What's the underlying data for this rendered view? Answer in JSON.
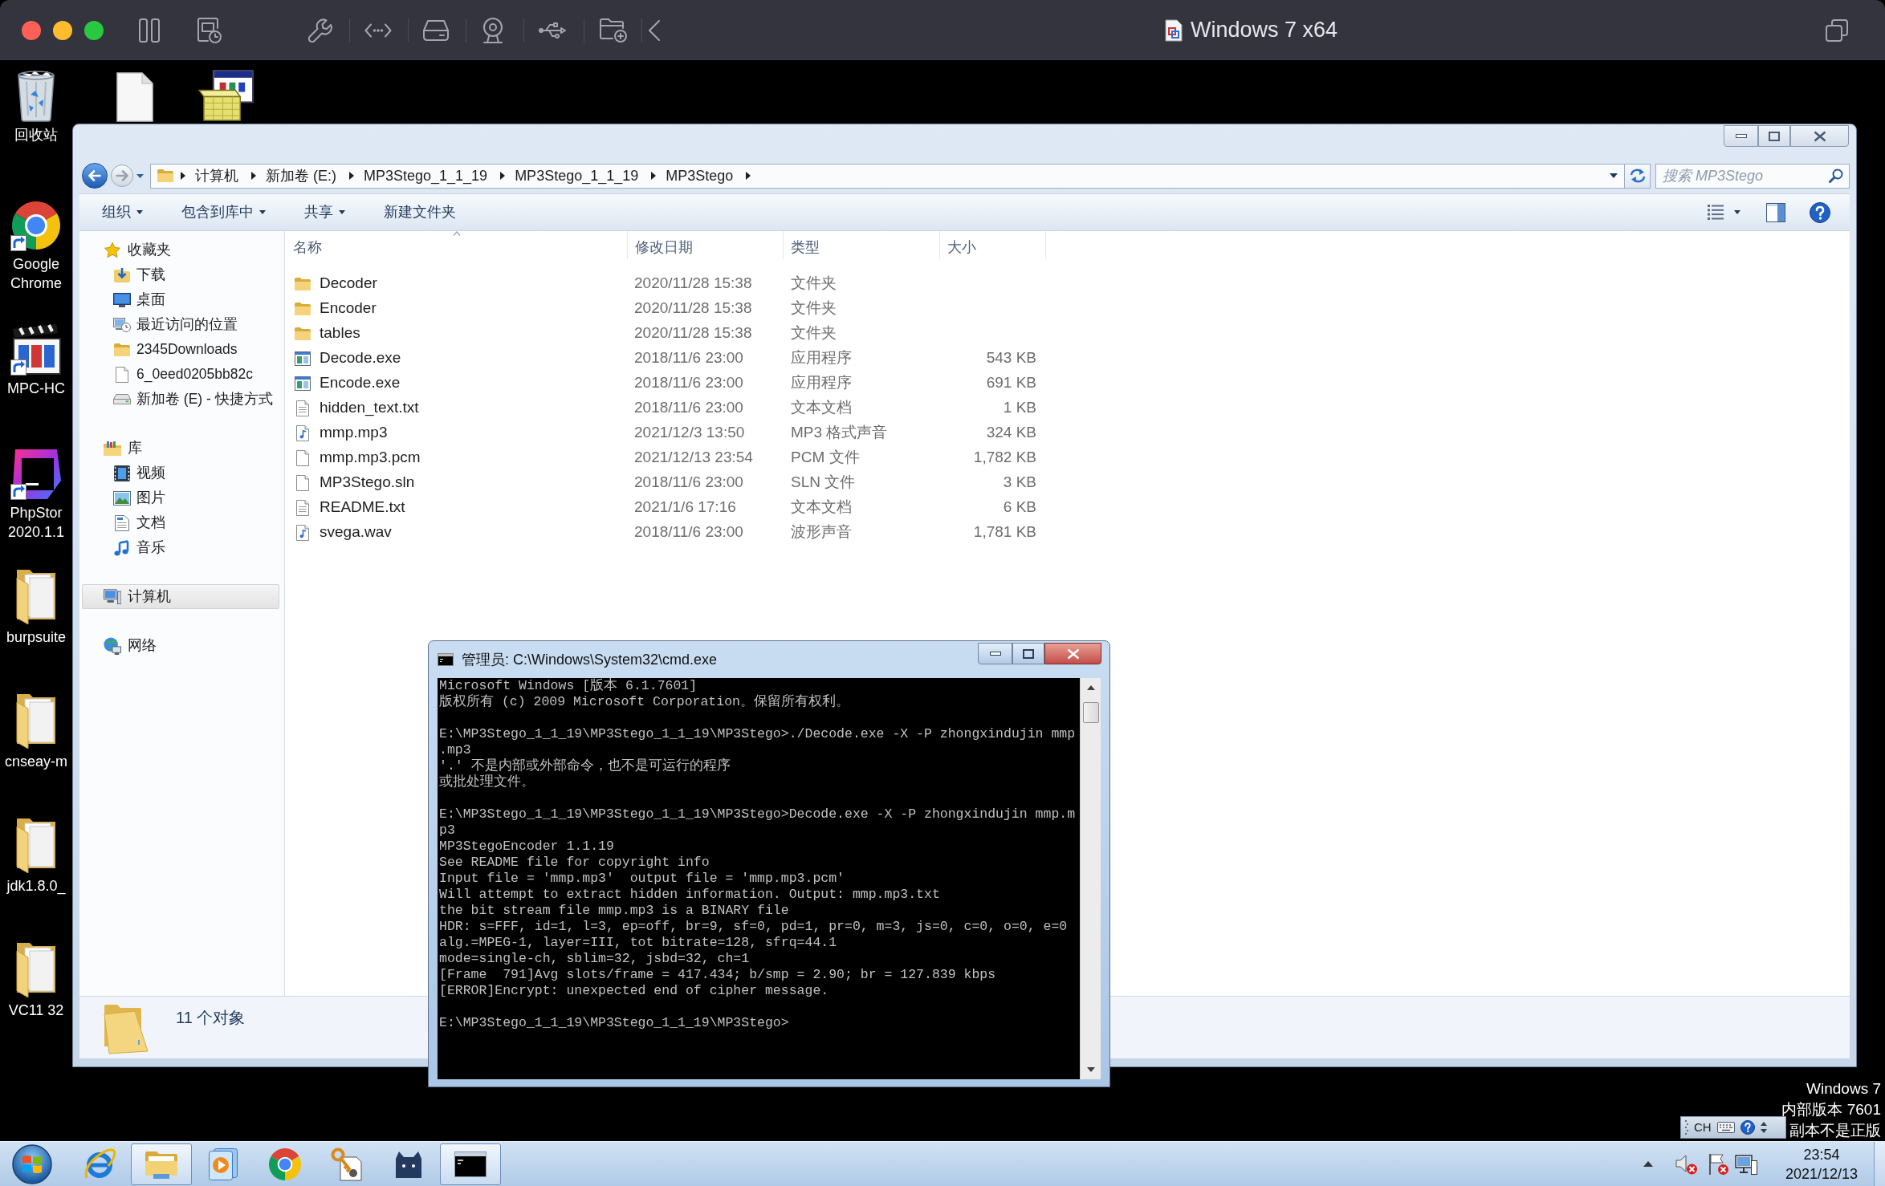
{
  "host_window": {
    "title": "Windows 7 x64"
  },
  "desktop": {
    "icons": [
      {
        "kind": "recycle_bin",
        "shortcut": false,
        "label": [
          "回收站"
        ]
      },
      {
        "kind": "document",
        "shortcut": false
      },
      {
        "kind": "installer",
        "shortcut": false
      },
      {
        "kind": "round_logo",
        "shortcut": true,
        "label": [
          "Google",
          "Chrome"
        ]
      },
      {
        "kind": "clapperboard",
        "shortcut": true,
        "label": [
          "MPC-HC"
        ]
      },
      {
        "kind": "app_tile",
        "shortcut": true,
        "label": [
          "PhpStor",
          "2020.1.1"
        ]
      },
      {
        "kind": "folder",
        "shortcut": false,
        "label": [
          "burpsuite"
        ]
      },
      {
        "kind": "folder",
        "shortcut": false,
        "label": [
          "cnseay-m"
        ]
      },
      {
        "kind": "folder",
        "shortcut": false,
        "label": [
          "jdk1.8.0_"
        ]
      },
      {
        "kind": "folder",
        "shortcut": false,
        "label": [
          "VC11 32"
        ]
      }
    ]
  },
  "explorer": {
    "history": {
      "back": {
        "disabled": false
      },
      "forward": {
        "disabled": true
      }
    },
    "breadcrumb": [
      "计算机",
      "新加卷 (E:)",
      "MP3Stego_1_1_19",
      "MP3Stego_1_1_19",
      "MP3Stego"
    ],
    "search": {
      "placeholder": "搜索 MP3Stego"
    },
    "toolbar": [
      {
        "label": "组织",
        "dropdown": true
      },
      {
        "label": "包含到库中",
        "dropdown": true
      },
      {
        "label": "共享",
        "dropdown": true
      },
      {
        "label": "新建文件夹",
        "dropdown": false
      }
    ],
    "nav": [
      {
        "label": "收藏夹",
        "kind": "star",
        "selected": false,
        "children": [
          {
            "label": "下载",
            "kind": "download",
            "selected": false
          },
          {
            "label": "桌面",
            "kind": "desktop",
            "selected": false
          },
          {
            "label": "最近访问的位置",
            "kind": "recent",
            "selected": false
          },
          {
            "label": "2345Downloads",
            "kind": "folder",
            "selected": false
          },
          {
            "label": "6_0eed0205bb82c",
            "kind": "file",
            "selected": false
          },
          {
            "label": "新加卷 (E) - 快捷方式",
            "kind": "drive",
            "selected": false
          }
        ]
      },
      {
        "label": "库",
        "kind": "library",
        "selected": false,
        "children": [
          {
            "label": "视频",
            "kind": "video",
            "selected": false
          },
          {
            "label": "图片",
            "kind": "pictures",
            "selected": false
          },
          {
            "label": "文档",
            "kind": "documents",
            "selected": false
          },
          {
            "label": "音乐",
            "kind": "music",
            "selected": false
          }
        ]
      },
      {
        "label": "计算机",
        "kind": "computer",
        "selected": true
      },
      {
        "label": "网络",
        "kind": "network",
        "selected": false
      }
    ],
    "columns": [
      {
        "label": "名称",
        "sorted": true
      },
      {
        "label": "修改日期",
        "sorted": false
      },
      {
        "label": "类型",
        "sorted": false
      },
      {
        "label": "大小",
        "sorted": false
      }
    ],
    "rows": [
      {
        "name": "Decoder",
        "kind": "folder",
        "modified": "2020/11/28 15:38",
        "type": "文件夹"
      },
      {
        "name": "Encoder",
        "kind": "folder",
        "modified": "2020/11/28 15:38",
        "type": "文件夹"
      },
      {
        "name": "tables",
        "kind": "folder",
        "modified": "2020/11/28 15:38",
        "type": "文件夹"
      },
      {
        "name": "Decode.exe",
        "kind": "application",
        "modified": "2018/11/6 23:00",
        "type": "应用程序",
        "size": "543 KB"
      },
      {
        "name": "Encode.exe",
        "kind": "application",
        "modified": "2018/11/6 23:00",
        "type": "应用程序",
        "size": "691 KB"
      },
      {
        "name": "hidden_text.txt",
        "kind": "text",
        "modified": "2018/11/6 23:00",
        "type": "文本文档",
        "size": "1 KB"
      },
      {
        "name": "mmp.mp3",
        "kind": "audio",
        "modified": "2021/12/3 13:50",
        "type": "MP3 格式声音",
        "size": "324 KB"
      },
      {
        "name": "mmp.mp3.pcm",
        "kind": "blank",
        "modified": "2021/12/13 23:54",
        "type": "PCM 文件",
        "size": "1,782 KB"
      },
      {
        "name": "MP3Stego.sln",
        "kind": "blank",
        "modified": "2018/11/6 23:00",
        "type": "SLN 文件",
        "size": "3 KB"
      },
      {
        "name": "README.txt",
        "kind": "text",
        "modified": "2021/1/6 17:16",
        "type": "文本文档",
        "size": "6 KB"
      },
      {
        "name": "svega.wav",
        "kind": "audio",
        "modified": "2018/11/6 23:00",
        "type": "波形声音",
        "size": "1,781 KB"
      }
    ],
    "status": "11 个对象"
  },
  "console": {
    "title": "管理员: C:\\Windows\\System32\\cmd.exe",
    "blocks": [
      [
        "Microsoft Windows [版本 6.1.7601]",
        "版权所有 (c) 2009 Microsoft Corporation。保留所有权利。"
      ],
      [
        "E:\\MP3Stego_1_1_19\\MP3Stego_1_1_19\\MP3Stego>./Decode.exe -X -P zhongxindujin mmp",
        ".mp3",
        "'.' 不是内部或外部命令，也不是可运行的程序",
        "或批处理文件。"
      ],
      [
        "E:\\MP3Stego_1_1_19\\MP3Stego_1_1_19\\MP3Stego>Decode.exe -X -P zhongxindujin mmp.m",
        "p3",
        "MP3StegoEncoder 1.1.19",
        "See README file for copyright info",
        "Input file = 'mmp.mp3'  output file = 'mmp.mp3.pcm'",
        "Will attempt to extract hidden information. Output: mmp.mp3.txt",
        "the bit stream file mmp.mp3 is a BINARY file",
        "HDR: s=FFF, id=1, l=3, ep=off, br=9, sf=0, pd=1, pr=0, m=3, js=0, c=0, o=0, e=0",
        "alg.=MPEG-1, layer=III, tot bitrate=128, sfrq=44.1",
        "mode=single-ch, sblim=32, jsbd=32, ch=1",
        "[Frame  791]Avg slots/frame = 417.434; b/smp = 2.90; br = 127.839 kbps",
        "[ERROR]Encrypt: unexpected end of cipher message."
      ],
      [
        "E:\\MP3Stego_1_1_19\\MP3Stego_1_1_19\\MP3Stego>"
      ]
    ]
  },
  "activation_notice": [
    "Windows 7",
    "内部版本 7601",
    "副本不是正版"
  ],
  "language_bar": {
    "label": "CH"
  },
  "taskbar": {
    "buttons": [
      {
        "kind": "browser",
        "running": false
      },
      {
        "kind": "folder",
        "running": true
      },
      {
        "kind": "player",
        "running": false
      },
      {
        "kind": "round_logo",
        "running": false
      },
      {
        "kind": "keys",
        "running": false
      },
      {
        "kind": "cat",
        "running": false
      },
      {
        "kind": "console",
        "running": true
      }
    ],
    "clock": {
      "time": "23:54",
      "date": "2021/12/13"
    }
  }
}
